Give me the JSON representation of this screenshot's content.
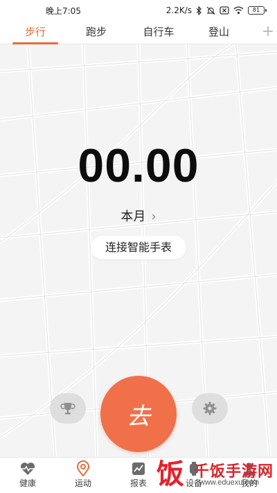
{
  "status_bar": {
    "time": "晚上7:05",
    "network_speed": "2.2K/s",
    "battery": "81",
    "icons": [
      "bluetooth-icon",
      "mute-bell-icon",
      "sim-off-icon",
      "wifi-icon",
      "battery-icon"
    ]
  },
  "tabs": [
    {
      "label": "步行",
      "active": true
    },
    {
      "label": "跑步",
      "active": false
    },
    {
      "label": "自行车",
      "active": false
    },
    {
      "label": "登山",
      "active": false
    }
  ],
  "add_tab_icon": "+",
  "main": {
    "value": "00.00",
    "period_label": "本月",
    "period_chevron": "›",
    "connect_label": "连接智能手表",
    "go_label": "去"
  },
  "actions": {
    "left_icon": "trophy-icon",
    "right_icon": "gear-icon"
  },
  "bottom_nav": [
    {
      "label": "健康",
      "icon": "heart-pulse-icon"
    },
    {
      "label": "运动",
      "icon": "location-pin-icon",
      "active": true
    },
    {
      "label": "报表",
      "icon": "chart-icon"
    },
    {
      "label": "设备",
      "icon": "device-icon"
    },
    {
      "label": "我的",
      "icon": "profile-icon"
    }
  ],
  "watermark": {
    "logo": "饭",
    "title": "千饭手游网",
    "url": "www.eduexu.com"
  },
  "colors": {
    "accent": "#e86a3a",
    "go_button": "#f0704a",
    "watermark_red": "#d8262c"
  }
}
